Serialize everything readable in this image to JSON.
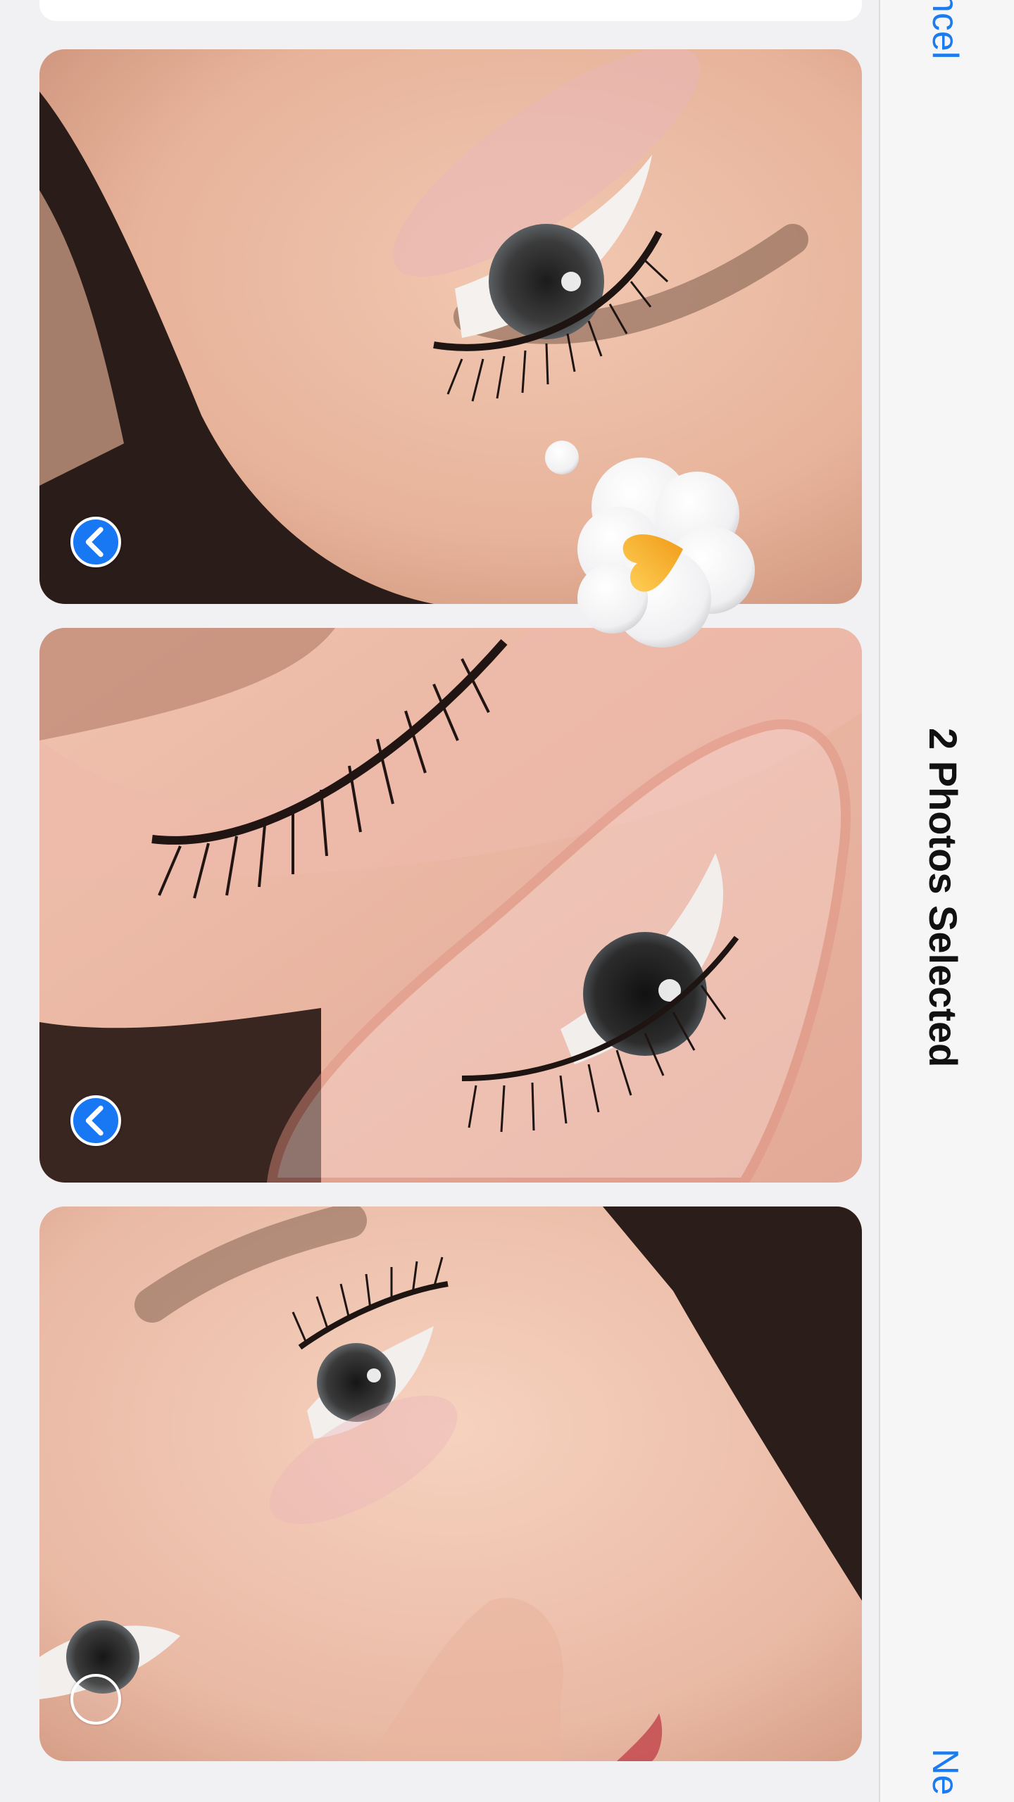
{
  "nav": {
    "cancel_label": "ancel",
    "title": "2 Photos Selected",
    "next_label": "Ne"
  },
  "photos": [
    {
      "name": "close-up eye photo with pink shadow",
      "selected": true
    },
    {
      "name": "lash lift with curler shield photo",
      "selected": true
    },
    {
      "name": "face close-up with lashes photo",
      "selected": false
    }
  ],
  "sticker": {
    "icon": "heart-thought-bubble-icon"
  },
  "colors": {
    "accent": "#1877F2",
    "background": "#F1F1F3",
    "navbar": "#F6F6F7",
    "heart": "#F5A623"
  }
}
